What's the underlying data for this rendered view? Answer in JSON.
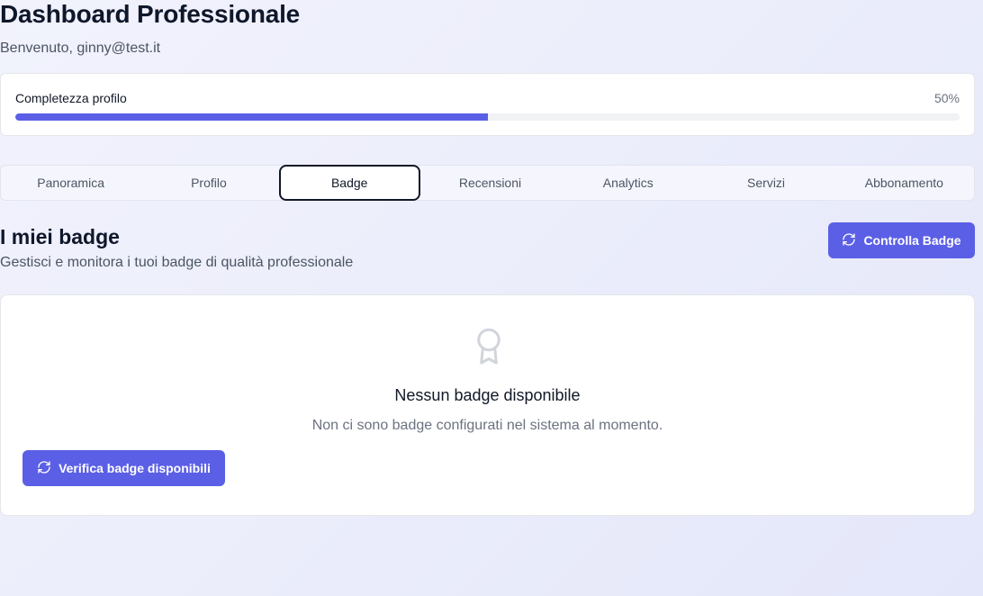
{
  "header": {
    "title": "Dashboard Professionale",
    "welcome": "Benvenuto, ginny@test.it"
  },
  "profile_progress": {
    "label": "Completezza profilo",
    "value_text": "50%",
    "fraction": 0.5
  },
  "tabs": [
    {
      "label": "Panoramica",
      "active": false
    },
    {
      "label": "Profilo",
      "active": false
    },
    {
      "label": "Badge",
      "active": true
    },
    {
      "label": "Recensioni",
      "active": false
    },
    {
      "label": "Analytics",
      "active": false
    },
    {
      "label": "Servizi",
      "active": false
    },
    {
      "label": "Abbonamento",
      "active": false
    }
  ],
  "badges_section": {
    "title": "I miei badge",
    "subtitle": "Gestisci e monitora i tuoi badge di qualità professionale",
    "check_button_label": "Controlla Badge"
  },
  "empty_state": {
    "icon": "award-icon",
    "title": "Nessun badge disponibile",
    "description": "Non ci sono badge configurati nel sistema al momento.",
    "verify_button_label": "Verifica badge disponibili"
  },
  "colors": {
    "accent": "#5b5fe6",
    "icon_muted": "#d1d5db"
  }
}
